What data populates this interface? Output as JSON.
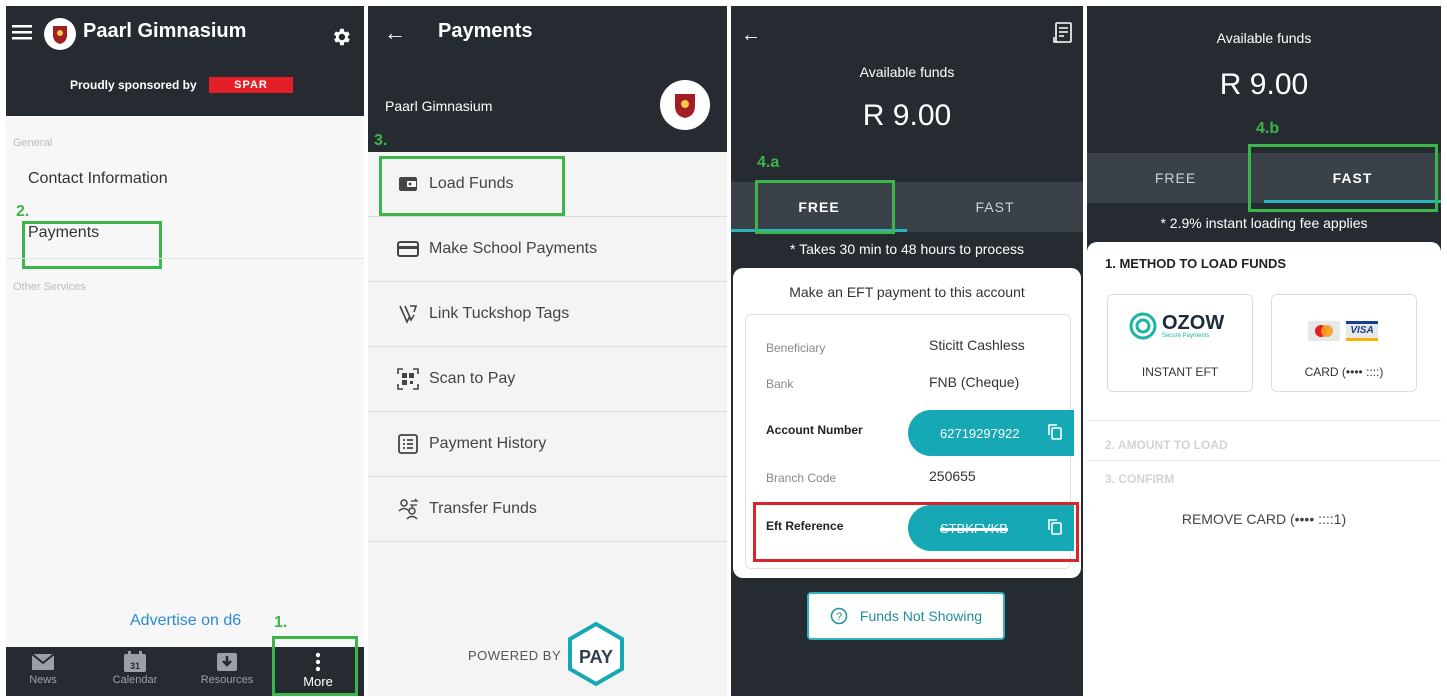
{
  "panel1": {
    "title": "Paarl Gimnasium",
    "sponsor_text": "Proudly sponsored by",
    "sponsor_brand": "SPAR",
    "section_general": "General",
    "contact_label": "Contact Information",
    "payments_label": "Payments",
    "section_other": "Other Services",
    "advertise_label": "Advertise on d6",
    "nav": [
      "News",
      "Calendar",
      "Resources",
      "More"
    ],
    "calendar_day": "31",
    "step1": "1.",
    "step2": "2."
  },
  "panel2": {
    "title": "Payments",
    "school": "Paarl Gimnasium",
    "step3": "3.",
    "menu": [
      "Load Funds",
      "Make School Payments",
      "Link Tuckshop Tags",
      "Scan to Pay",
      "Payment History",
      "Transfer Funds"
    ],
    "powered_by": "POWERED BY",
    "pay_logo": "PAY"
  },
  "panel3": {
    "available_label": "Available funds",
    "amount": "R 9.00",
    "step": "4.a",
    "tabs": [
      "FREE",
      "FAST"
    ],
    "note": "* Takes 30 min to 48 hours to process",
    "card_title": "Make an EFT payment to this account",
    "beneficiary_label": "Beneficiary",
    "beneficiary_value": "Sticitt Cashless",
    "bank_label": "Bank",
    "bank_value": "FNB (Cheque)",
    "account_label": "Account Number",
    "account_value": "62719297922",
    "branch_label": "Branch Code",
    "branch_value": "250655",
    "eft_label": "Eft Reference",
    "eft_value": "STBKFVKB",
    "funds_button": "Funds Not Showing"
  },
  "panel4": {
    "available_label": "Available funds",
    "amount": "R 9.00",
    "step": "4.b",
    "tabs": [
      "FREE",
      "FAST"
    ],
    "note": "* 2.9% instant loading fee applies",
    "method_title": "1. METHOD TO LOAD FUNDS",
    "ozow_logo": "OZOW",
    "ozow_sub": "Secure Payments",
    "visa_logo": "VISA",
    "instant_eft": "INSTANT EFT",
    "card_label": "CARD (•••• ::::)",
    "amount_title": "2. AMOUNT TO LOAD",
    "confirm_title": "3. CONFIRM",
    "remove_card": "REMOVE CARD (•••• ::::1)"
  },
  "colors": {
    "header_dark": "#262b31",
    "accent_teal": "#16a8b5",
    "highlight_green": "#3cb54a",
    "highlight_red": "#d9252a",
    "spar_red": "#e41e26"
  }
}
